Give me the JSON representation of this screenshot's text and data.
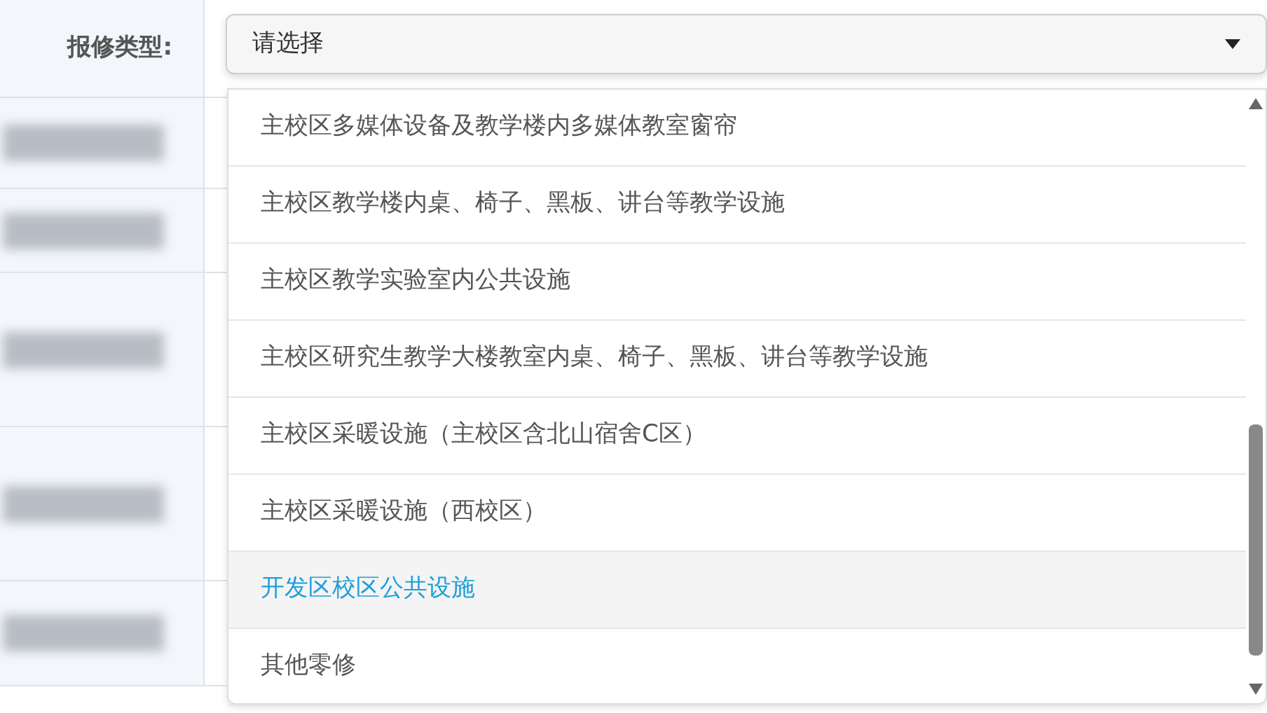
{
  "field": {
    "label": "报修类型:",
    "value": "请选择",
    "expanded": true
  },
  "options": [
    {
      "label": "主校区多媒体设备及教学楼内多媒体教室窗帘",
      "selected": false
    },
    {
      "label": "主校区教学楼内桌、椅子、黑板、讲台等教学设施",
      "selected": false
    },
    {
      "label": "主校区教学实验室内公共设施",
      "selected": false
    },
    {
      "label": "主校区研究生教学大楼教室内桌、椅子、黑板、讲台等教学设施",
      "selected": false
    },
    {
      "label": "主校区采暖设施（主校区含北山宿舍C区）",
      "selected": false
    },
    {
      "label": "主校区采暖设施（西校区）",
      "selected": false
    },
    {
      "label": "开发区校区公共设施",
      "selected": true
    },
    {
      "label": "其他零修",
      "selected": false
    }
  ]
}
